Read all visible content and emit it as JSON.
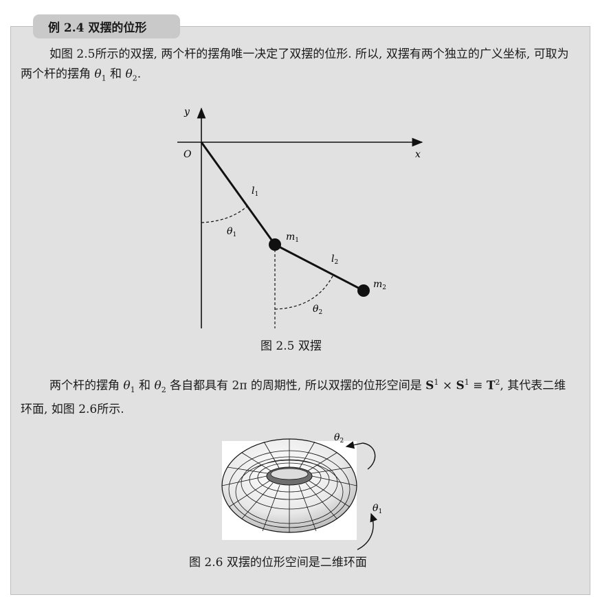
{
  "example": {
    "tab": "例 2.4 双摆的位形"
  },
  "para1": {
    "part1": "如图 2.5所示的双摆, 两个杆的摆角唯一决定了双摆的位形. 所以, 双摆有两个独立的广义坐标, 可取为两个杆的摆角 ",
    "theta1": "θ",
    "sub1": "1",
    "and": " 和 ",
    "theta2": "θ",
    "sub2": "2",
    "end": "."
  },
  "figure1": {
    "y_axis": "y",
    "x_axis": "x",
    "origin": "O",
    "l1": "l",
    "l1_sub": "1",
    "l2": "l",
    "l2_sub": "2",
    "m1": "m",
    "m1_sub": "1",
    "m2": "m",
    "m2_sub": "2",
    "theta1": "θ",
    "theta1_sub": "1",
    "theta2": "θ",
    "theta2_sub": "2",
    "caption": "图 2.5    双摆"
  },
  "para2": {
    "part1": "两个杆的摆角 ",
    "theta1": "θ",
    "sub1": "1",
    "and": " 和 ",
    "theta2": "θ",
    "sub2": "2",
    "part2": " 各自都具有 2π 的周期性, 所以双摆的位形空间是 ",
    "s1": "S",
    "sup1": "1",
    "times": " × ",
    "s2": "S",
    "sup2": "1",
    "equiv": " ≡ ",
    "t": "T",
    "sup3": "2",
    "part3": ", 其代表二维环面, 如图 2.6所示."
  },
  "figure2": {
    "theta1": "θ",
    "theta1_sub": "1",
    "theta2": "θ",
    "theta2_sub": "2",
    "caption": "图 2.6    双摆的位形空间是二维环面"
  }
}
